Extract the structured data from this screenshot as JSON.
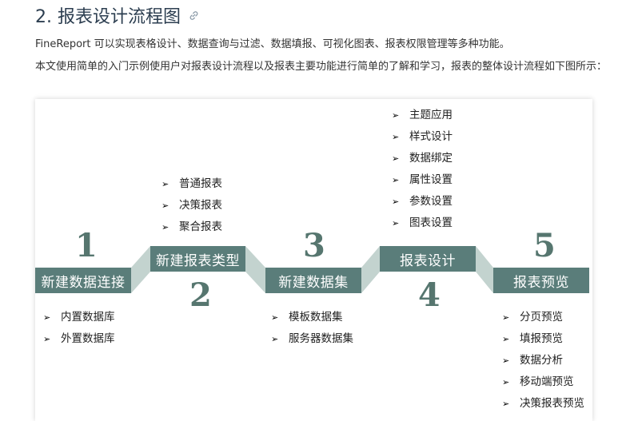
{
  "section": {
    "heading": "2. 报表设计流程图",
    "intro": "FineReport 可以实现表格设计、数据查询与过滤、数据填报、可视化图表、报表权限管理等多种功能。",
    "description": "本文使用简单的入门示例使用户对报表设计流程以及报表主要功能进行简单的了解和学习，报表的整体设计流程如下图所示："
  },
  "flow": {
    "stages": [
      {
        "number": "1",
        "title": "新建数据连接",
        "items": [
          "内置数据库",
          "外置数据库"
        ]
      },
      {
        "number": "2",
        "title": "新建报表类型",
        "items": [
          "普通报表",
          "决策报表",
          "聚合报表"
        ]
      },
      {
        "number": "3",
        "title": "新建数据集",
        "items": [
          "模板数据集",
          "服务器数据集"
        ]
      },
      {
        "number": "4",
        "title": "报表设计",
        "items": [
          "主题应用",
          "样式设计",
          "数据绑定",
          "属性设置",
          "参数设置",
          "图表设置"
        ]
      },
      {
        "number": "5",
        "title": "报表预览",
        "items": [
          "分页预览",
          "填报预览",
          "数据分析",
          "移动端预览",
          "决策报表预览"
        ]
      }
    ],
    "bullet_glyph": "➢"
  },
  "colors": {
    "stage_fill": "#5a7d7a",
    "connector_fill": "#c3d3cf",
    "number_color": "#56766f"
  }
}
